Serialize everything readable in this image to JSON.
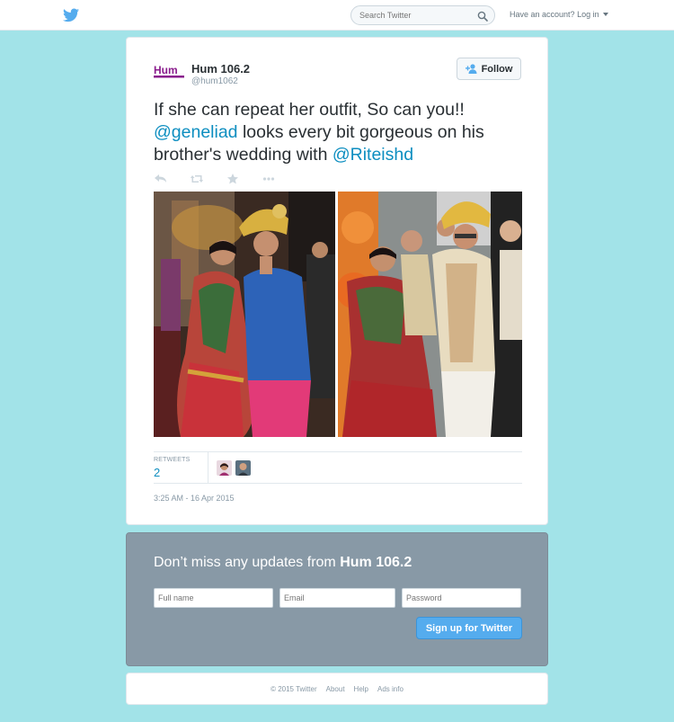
{
  "topbar": {
    "search_placeholder": "Search Twitter",
    "account_text": "Have an account?",
    "login_label": "Log in"
  },
  "tweet": {
    "display_name": "Hum 106.2",
    "handle": "@hum1062",
    "follow_label": "Follow",
    "text_part1": "If she can repeat her outfit, So can you!! ",
    "mention1": "@geneliad",
    "text_part2": " looks every bit gorgeous on his brother's wedding with ",
    "mention2": "@Riteishd",
    "retweets_label": "RETWEETS",
    "retweets_count": "2",
    "timestamp": "3:25 AM - 16 Apr 2015",
    "avatar_logo_text": "Hum"
  },
  "signup": {
    "title_prefix": "Don’t miss any updates from ",
    "title_name": "Hum 106.2",
    "fullname_placeholder": "Full name",
    "email_placeholder": "Email",
    "password_placeholder": "Password",
    "button_label": "Sign up for Twitter"
  },
  "footer": {
    "copyright": "© 2015 Twitter",
    "about": "About",
    "help": "Help",
    "ads_info": "Ads info"
  },
  "colors": {
    "page_background": "#a2e3e8",
    "link_blue": "#0d8ec0",
    "twitter_blue": "#55acee",
    "signup_panel": "#8899a6"
  }
}
